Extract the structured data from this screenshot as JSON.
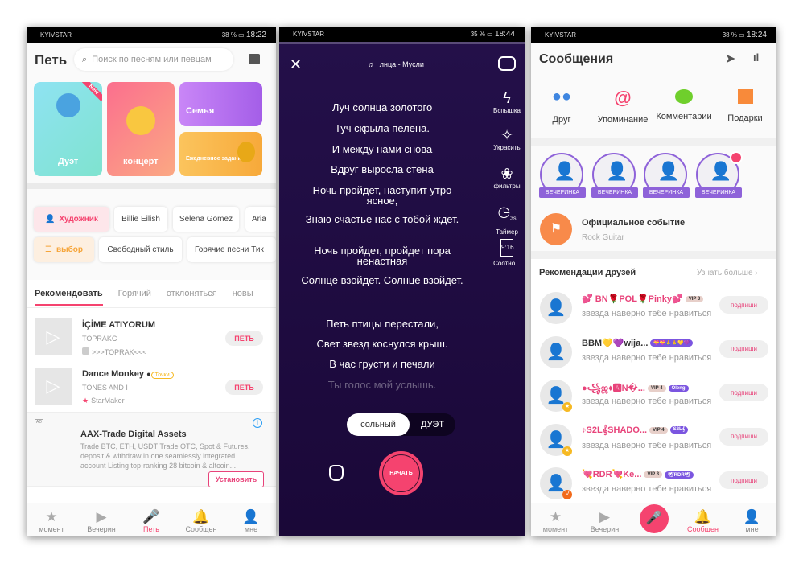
{
  "status": [
    {
      "carrier": "KYIVSTAR",
      "battery": "38 %",
      "time": "18:22"
    },
    {
      "carrier": "KYIVSTAR",
      "battery": "35 %",
      "time": "18:44"
    },
    {
      "carrier": "KYIVSTAR",
      "battery": "38 %",
      "time": "18:24"
    }
  ],
  "sing": {
    "title": "Петь",
    "search_placeholder": "Поиск по песням или певцам",
    "banners": {
      "duet": "Дуэт",
      "duet_badge": "New",
      "concert": "концерт",
      "family": "Семья",
      "daily": "Ежедневное задание"
    },
    "chips_row1": [
      "Художник",
      "Billie Eilish",
      "Selena Gomez",
      "Aria"
    ],
    "chips_row2": [
      "выбор",
      "Свободный стиль",
      "Горячие песни Тик"
    ],
    "tabs": [
      "Рекомендовать",
      "Горячий",
      "отклоняться",
      "новы"
    ],
    "songs": [
      {
        "title": "İÇİME ATIYORUM",
        "artist": "TOPRAKC",
        "uploader": ">>>TOPRAK<<<",
        "button": "ПЕТЬ"
      },
      {
        "title": "Dance Monkey",
        "badge": "Точки",
        "artist": "TONES AND I",
        "uploader": "StarMaker",
        "button": "ПЕТЬ"
      }
    ],
    "ad": {
      "label": "AD",
      "title": "AAX-Trade Digital Assets",
      "text": "Trade BTC, ETH, USDT Trade OTC, Spot & Futures, deposit & withdraw in one seamlessly integrated account Listing top-ranking 28 bitcoin & altcoin...",
      "button": "Установить"
    }
  },
  "nav": [
    "момент",
    "Вечерин",
    "Петь",
    "Сообщен",
    "мне"
  ],
  "recorder": {
    "song": "лнца - Мусли",
    "lyrics": [
      "Луч солнца золотого",
      "Туч скрыла пелена.",
      "И между нами снова",
      "Вдруг выросла стена",
      "Ночь пройдет, наступит утро ясное,",
      "Знаю счастье нас с тобой ждет.",
      "Ночь пройдет, пройдет пора ненастная",
      "Солнце взойдет. Солнце взойдет.",
      "Петь птицы перестали,",
      "Свет звезд коснулся крыш.",
      "В час грусти и печали",
      "Ты голос мой услышь."
    ],
    "tools": [
      "Вспышка",
      "Украсить",
      "фильтры",
      "Таймер",
      "Соотно..."
    ],
    "timer_badge": "3s",
    "ratio_badge": "9:16",
    "mode_solo": "сольный",
    "mode_duet": "ДУЭТ",
    "start": "НАЧАТЬ"
  },
  "messages": {
    "title": "Сообщения",
    "categories": [
      "Друг",
      "Упоминание",
      "Комментарии",
      "Подарки"
    ],
    "party_label": "ВЕЧЕРИНКА",
    "event_title": "Официальное событие",
    "event_sub": "Rock Guitar",
    "rec_title": "Рекомендации друзей",
    "rec_more": "Узнать больше",
    "friends": [
      {
        "name": "💕 BN🌹POL🌹Pinky💕",
        "badges": [
          "VIP 3"
        ],
        "sub": "звезда наверно тебе нравиться",
        "button": "подпиши"
      },
      {
        "name": "BBM💛💜wija...",
        "badges": [
          "💝💝🙏🙏💛💜"
        ],
        "sub": "звезда наверно тебе нравиться",
        "button": "подпиши"
      },
      {
        "name": "●꧁ஜ♦🅰N�...",
        "badges": [
          "VIP 4",
          "Oleng"
        ],
        "sub": "звезда наверно тебе нравиться",
        "button": "подпиши"
      },
      {
        "name": "♪S2L𝄞SHADO...",
        "badges": [
          "VIP 4",
          "S2L𝄞"
        ],
        "sub": "звезда наверно тебе нравиться",
        "button": "подпиши"
      },
      {
        "name": "💘RDR💘Ke...",
        "badges": [
          "VIP 3",
          "🕊RDR🕊"
        ],
        "sub": "звезда наверно тебе нравиться",
        "button": "подпиши"
      }
    ]
  },
  "colors": {
    "accent": "#f5436f",
    "recorder_bg": "#1d0b3e",
    "party": "#8e62d9"
  }
}
